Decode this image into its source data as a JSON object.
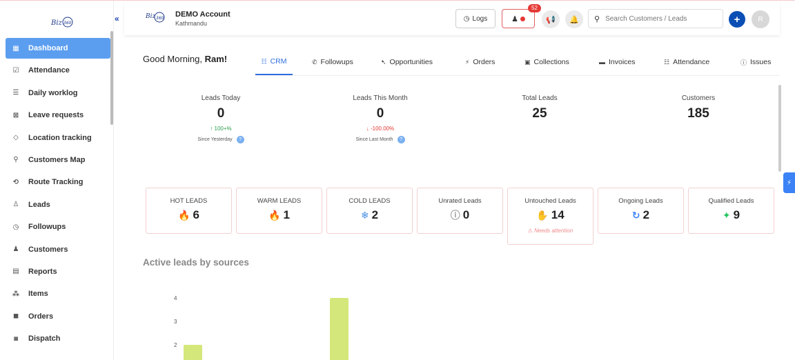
{
  "sidebar": {
    "logo_text": "Biz360",
    "items": [
      {
        "label": "Dashboard",
        "icon": "grid-icon",
        "glyph": "▦"
      },
      {
        "label": "Attendance",
        "icon": "calendar-check-icon",
        "glyph": "☑"
      },
      {
        "label": "Daily worklog",
        "icon": "list-icon",
        "glyph": "☰"
      },
      {
        "label": "Leave requests",
        "icon": "calendar-x-icon",
        "glyph": "⊠"
      },
      {
        "label": "Location tracking",
        "icon": "crosshair-icon",
        "glyph": "◇"
      },
      {
        "label": "Customers Map",
        "icon": "map-pin-user-icon",
        "glyph": "⚲"
      },
      {
        "label": "Route Tracking",
        "icon": "route-icon",
        "glyph": "⟲"
      },
      {
        "label": "Leads",
        "icon": "user-icon",
        "glyph": "♙"
      },
      {
        "label": "Followups",
        "icon": "clock-icon",
        "glyph": "◷"
      },
      {
        "label": "Customers",
        "icon": "user-check-icon",
        "glyph": "♟"
      },
      {
        "label": "Reports",
        "icon": "chart-icon",
        "glyph": "▤"
      },
      {
        "label": "Items",
        "icon": "hierarchy-icon",
        "glyph": "⁂"
      },
      {
        "label": "Orders",
        "icon": "shopping-bag-icon",
        "glyph": "◼"
      },
      {
        "label": "Dispatch",
        "icon": "truck-icon",
        "glyph": "◙"
      }
    ],
    "collapse_glyph": "«"
  },
  "header": {
    "account_logo": "Biz360",
    "account_name": "DEMO Account",
    "account_location": "Kathmandu",
    "logs_label": "Logs",
    "notification_count": "52",
    "search_placeholder": "Search Customers / Leads",
    "add_glyph": "+",
    "avatar_initial": "R"
  },
  "greeting": {
    "prefix": "Good Morning, ",
    "name": "Ram!"
  },
  "tabs": [
    {
      "label": "CRM",
      "glyph": "☷",
      "active": true
    },
    {
      "label": "Followups",
      "glyph": "✆",
      "active": false
    },
    {
      "label": "Opportunities",
      "glyph": "➷",
      "active": false
    },
    {
      "label": "Orders",
      "glyph": "⚡",
      "active": false
    },
    {
      "label": "Collections",
      "glyph": "▣",
      "active": false
    },
    {
      "label": "Invoices",
      "glyph": "▬",
      "active": false
    },
    {
      "label": "Attendance",
      "glyph": "☷",
      "active": false
    },
    {
      "label": "Issues",
      "glyph": "ⓘ",
      "active": false
    }
  ],
  "stats": [
    {
      "label": "Leads Today",
      "value": "0",
      "change": "↑ 100+%",
      "change_color": "#2e9e4f",
      "since": "Since Yesterday"
    },
    {
      "label": "Leads This Month",
      "value": "0",
      "change": "↓ -100.00%",
      "change_color": "#e53935",
      "since": "Since Last Month"
    },
    {
      "label": "Total Leads",
      "value": "25",
      "change": "",
      "since": ""
    },
    {
      "label": "Customers",
      "value": "185",
      "change": "",
      "since": ""
    }
  ],
  "lead_cards": [
    {
      "label": "HOT LEADS",
      "value": "6",
      "icon": "fire-icon",
      "glyph": "🔥",
      "color": "#e53935"
    },
    {
      "label": "WARM LEADS",
      "value": "1",
      "icon": "flame-icon",
      "glyph": "🔥",
      "color": "#f57c00"
    },
    {
      "label": "COLD LEADS",
      "value": "2",
      "icon": "snowflake-icon",
      "glyph": "❄",
      "color": "#4a90e2"
    },
    {
      "label": "Unrated Leads",
      "value": "0",
      "icon": "info-icon",
      "glyph": "ⓘ",
      "color": "#999999"
    },
    {
      "label": "Untouched Leads",
      "value": "14",
      "icon": "hand-icon",
      "glyph": "✋",
      "color": "#e53935",
      "note": "⚠ Needs attention"
    },
    {
      "label": "Ongoing Leads",
      "value": "2",
      "icon": "refresh-icon",
      "glyph": "↻",
      "color": "#3b82f6"
    },
    {
      "label": "Qualified Leads",
      "value": "9",
      "icon": "sparkle-icon",
      "glyph": "✦",
      "color": "#22c55e"
    }
  ],
  "chart_title": "Active leads by sources",
  "chart_data": {
    "type": "bar",
    "title": "Active leads by sources",
    "categories": [
      "",
      ""
    ],
    "values": [
      2,
      4
    ],
    "y_ticks": [
      2,
      3,
      4
    ],
    "bar_color": "#d4e77a"
  }
}
